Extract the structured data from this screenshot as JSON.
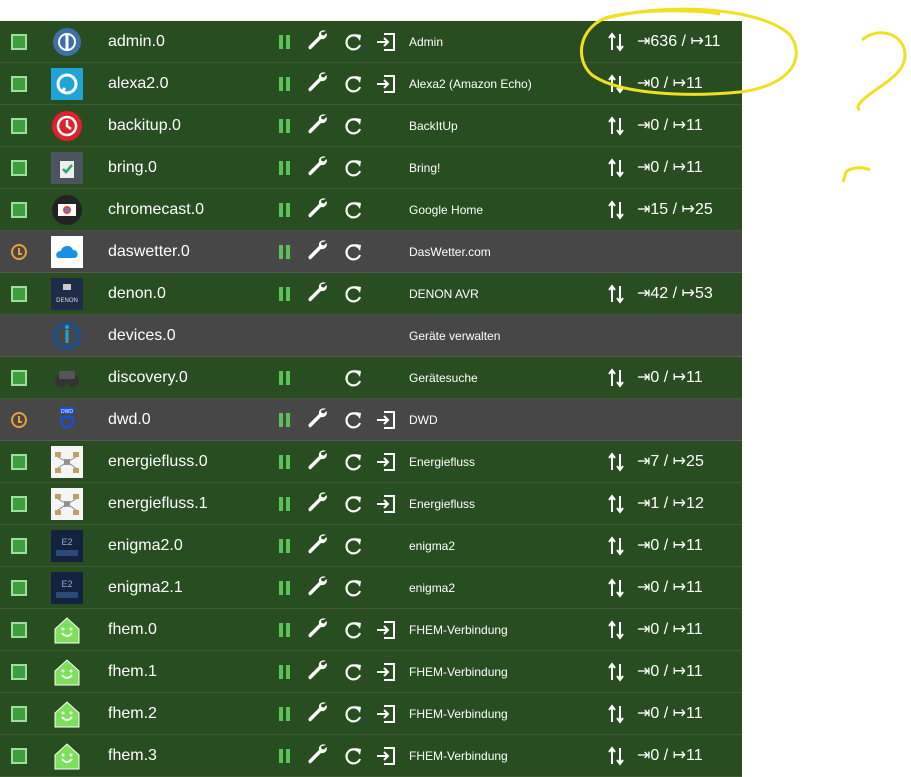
{
  "colors": {
    "row_green": "#284d20",
    "row_gray": "#474747",
    "status_green": "#3d9e3d",
    "status_clock": "#e8a03c",
    "pause_green": "#58c458",
    "annotation_yellow": "#f0e022"
  },
  "instances": [
    {
      "name": "admin.0",
      "title": "Admin",
      "status": "ok",
      "row": "green",
      "logo": "iobroker-admin-logo",
      "show_pause": true,
      "show_wrench": true,
      "show_reload": true,
      "show_link": true,
      "show_conn": true,
      "counts": "⇥636 / ↦11"
    },
    {
      "name": "alexa2.0",
      "title": "Alexa2 (Amazon Echo)",
      "status": "ok",
      "row": "green",
      "logo": "alexa-logo",
      "show_pause": true,
      "show_wrench": true,
      "show_reload": true,
      "show_link": true,
      "show_conn": true,
      "counts": "⇥0 / ↦11"
    },
    {
      "name": "backitup.0",
      "title": "BackItUp",
      "status": "ok",
      "row": "green",
      "logo": "backitup-logo",
      "show_pause": true,
      "show_wrench": true,
      "show_reload": true,
      "show_link": false,
      "show_conn": true,
      "counts": "⇥0 / ↦11"
    },
    {
      "name": "bring.0",
      "title": "Bring!",
      "status": "ok",
      "row": "green",
      "logo": "bring-logo",
      "show_pause": true,
      "show_wrench": true,
      "show_reload": true,
      "show_link": false,
      "show_conn": true,
      "counts": "⇥0 / ↦11"
    },
    {
      "name": "chromecast.0",
      "title": "Google Home",
      "status": "ok",
      "row": "green",
      "logo": "chromecast-logo",
      "show_pause": true,
      "show_wrench": true,
      "show_reload": true,
      "show_link": false,
      "show_conn": true,
      "counts": "⇥15 / ↦25"
    },
    {
      "name": "daswetter.0",
      "title": "DasWetter.com",
      "status": "clock",
      "row": "gray",
      "logo": "daswetter-logo",
      "show_pause": true,
      "show_wrench": true,
      "show_reload": true,
      "show_link": false,
      "show_conn": false,
      "counts": ""
    },
    {
      "name": "denon.0",
      "title": "DENON AVR",
      "status": "ok",
      "row": "green",
      "logo": "denon-logo",
      "show_pause": true,
      "show_wrench": true,
      "show_reload": true,
      "show_link": false,
      "show_conn": true,
      "counts": "⇥42 / ↦53"
    },
    {
      "name": "devices.0",
      "title": "Geräte verwalten",
      "status": "none",
      "row": "gray",
      "logo": "devices-logo",
      "show_pause": false,
      "show_wrench": false,
      "show_reload": false,
      "show_link": false,
      "show_conn": false,
      "counts": ""
    },
    {
      "name": "discovery.0",
      "title": "Gerätesuche",
      "status": "ok",
      "row": "green",
      "logo": "discovery-logo",
      "show_pause": true,
      "show_wrench": false,
      "show_reload": true,
      "show_link": false,
      "show_conn": true,
      "counts": "⇥0 / ↦11"
    },
    {
      "name": "dwd.0",
      "title": "DWD",
      "status": "clock",
      "row": "gray",
      "logo": "dwd-logo",
      "show_pause": true,
      "show_wrench": true,
      "show_reload": true,
      "show_link": true,
      "show_conn": false,
      "counts": ""
    },
    {
      "name": "energiefluss.0",
      "title": "Energiefluss",
      "status": "ok",
      "row": "green",
      "logo": "energiefluss-logo",
      "show_pause": true,
      "show_wrench": true,
      "show_reload": true,
      "show_link": true,
      "show_conn": true,
      "counts": "⇥7 / ↦25"
    },
    {
      "name": "energiefluss.1",
      "title": "Energiefluss",
      "status": "ok",
      "row": "green",
      "logo": "energiefluss-logo",
      "show_pause": true,
      "show_wrench": true,
      "show_reload": true,
      "show_link": true,
      "show_conn": true,
      "counts": "⇥1 / ↦12"
    },
    {
      "name": "enigma2.0",
      "title": "enigma2",
      "status": "ok",
      "row": "green",
      "logo": "enigma2-logo",
      "show_pause": true,
      "show_wrench": true,
      "show_reload": true,
      "show_link": false,
      "show_conn": true,
      "counts": "⇥0 / ↦11"
    },
    {
      "name": "enigma2.1",
      "title": "enigma2",
      "status": "ok",
      "row": "green",
      "logo": "enigma2-logo",
      "show_pause": true,
      "show_wrench": true,
      "show_reload": true,
      "show_link": false,
      "show_conn": true,
      "counts": "⇥0 / ↦11"
    },
    {
      "name": "fhem.0",
      "title": "FHEM-Verbindung",
      "status": "ok",
      "row": "green",
      "logo": "fhem-logo",
      "show_pause": true,
      "show_wrench": true,
      "show_reload": true,
      "show_link": true,
      "show_conn": true,
      "counts": "⇥0 / ↦11"
    },
    {
      "name": "fhem.1",
      "title": "FHEM-Verbindung",
      "status": "ok",
      "row": "green",
      "logo": "fhem-logo",
      "show_pause": true,
      "show_wrench": true,
      "show_reload": true,
      "show_link": true,
      "show_conn": true,
      "counts": "⇥0 / ↦11"
    },
    {
      "name": "fhem.2",
      "title": "FHEM-Verbindung",
      "status": "ok",
      "row": "green",
      "logo": "fhem-logo",
      "show_pause": true,
      "show_wrench": true,
      "show_reload": true,
      "show_link": true,
      "show_conn": true,
      "counts": "⇥0 / ↦11"
    },
    {
      "name": "fhem.3",
      "title": "FHEM-Verbindung",
      "status": "ok",
      "row": "green",
      "logo": "fhem-logo",
      "show_pause": true,
      "show_wrench": true,
      "show_reload": true,
      "show_link": true,
      "show_conn": true,
      "counts": "⇥0 / ↦11"
    }
  ]
}
